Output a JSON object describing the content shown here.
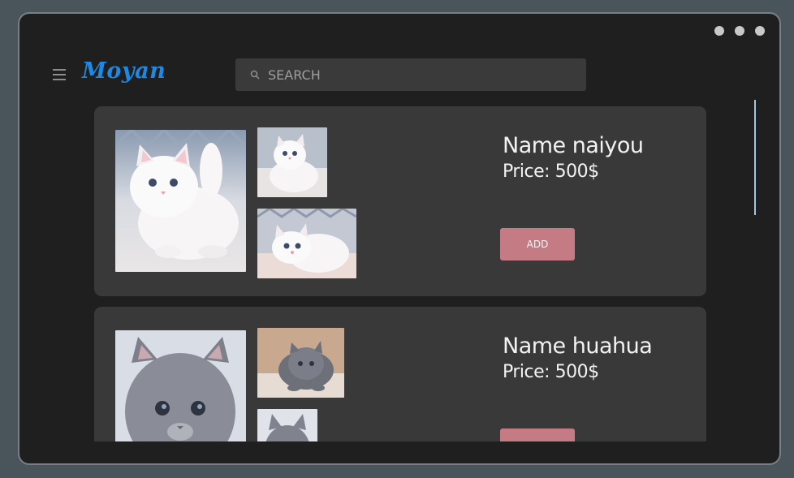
{
  "window": {
    "controls": [
      "dot",
      "dot",
      "dot"
    ]
  },
  "header": {
    "menu_icon": "hamburger-icon",
    "logo": "Moyan",
    "search": {
      "placeholder": "SEARCH",
      "value": "",
      "icon": "search-icon"
    }
  },
  "colors": {
    "background": "#1f1f1f",
    "card": "#393939",
    "accent_logo": "#1e88e5",
    "button": "#c47b84",
    "search_bg": "#3a3a3a"
  },
  "products": [
    {
      "name": "Name naiyou",
      "price": "Price: 500$",
      "button": "ADD",
      "images": [
        "white-kitten-photo",
        "white-kitten-photo",
        "white-kitten-photo"
      ]
    },
    {
      "name": "Name huahua",
      "price": "Price: 500$",
      "button": "",
      "images": [
        "gray-kitten-photo",
        "gray-kitten-photo",
        "gray-kitten-photo"
      ]
    }
  ]
}
